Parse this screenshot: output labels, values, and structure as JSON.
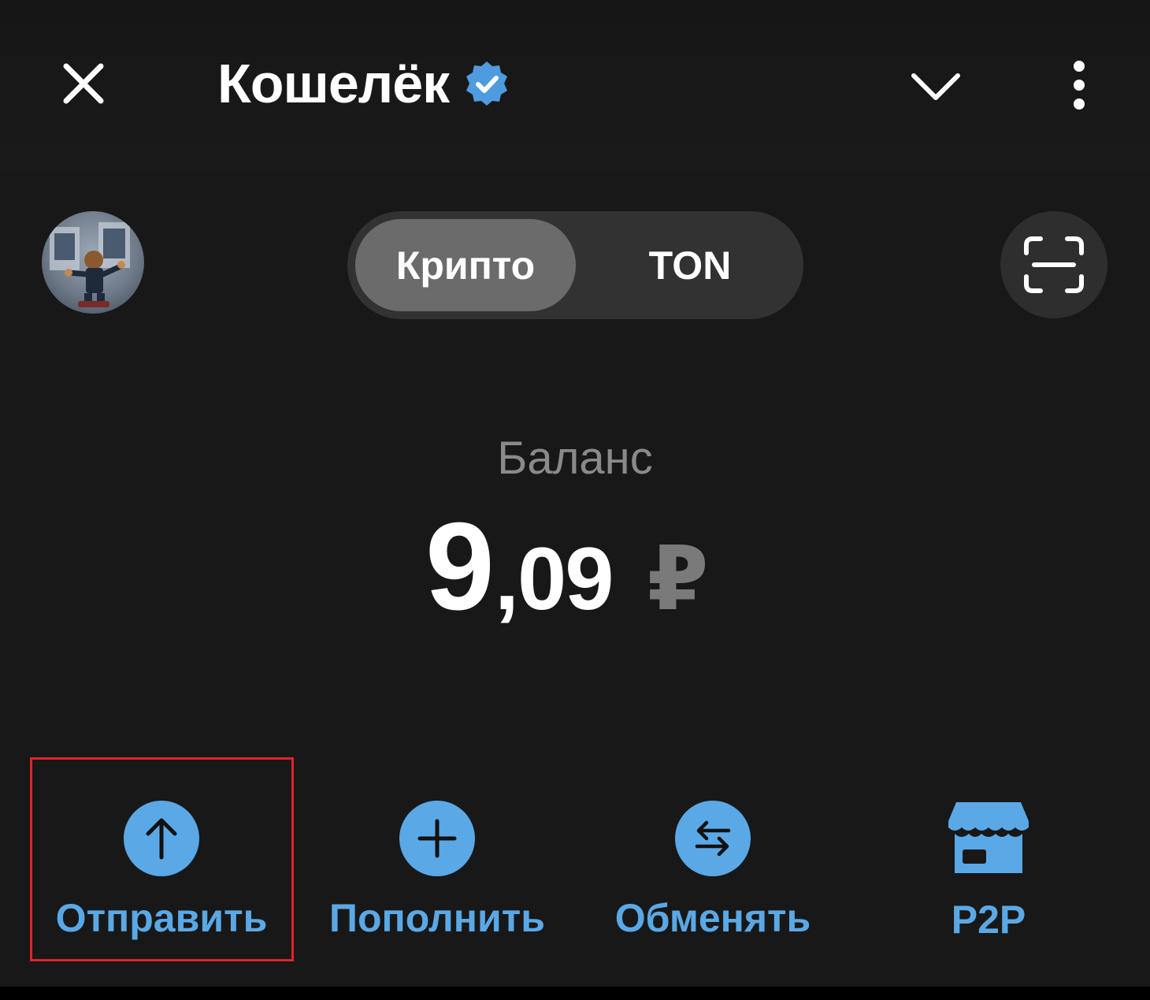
{
  "header": {
    "title": "Кошелёк",
    "verified_icon": "verified-badge-icon",
    "close_icon": "close-icon",
    "dropdown_icon": "chevron-down-icon",
    "menu_icon": "more-vertical-icon"
  },
  "tabs": [
    {
      "label": "Крипто",
      "selected": true
    },
    {
      "label": "TON",
      "selected": false
    }
  ],
  "scan_icon": "qr-scan-icon",
  "balance": {
    "label": "Баланс",
    "integer": "9",
    "fraction": ",09",
    "currency": "₽"
  },
  "actions": [
    {
      "label": "Отправить",
      "icon": "arrow-up-icon"
    },
    {
      "label": "Пополнить",
      "icon": "plus-icon"
    },
    {
      "label": "Обменять",
      "icon": "swap-icon"
    },
    {
      "label": "P2P",
      "icon": "store-icon"
    }
  ],
  "colors": {
    "background": "#181818",
    "accent": "#5aa8e6",
    "segment_bg": "#323232",
    "segment_selected": "#6b6b6b",
    "muted_text": "#8a8a8a",
    "highlight": "#e0242a"
  }
}
